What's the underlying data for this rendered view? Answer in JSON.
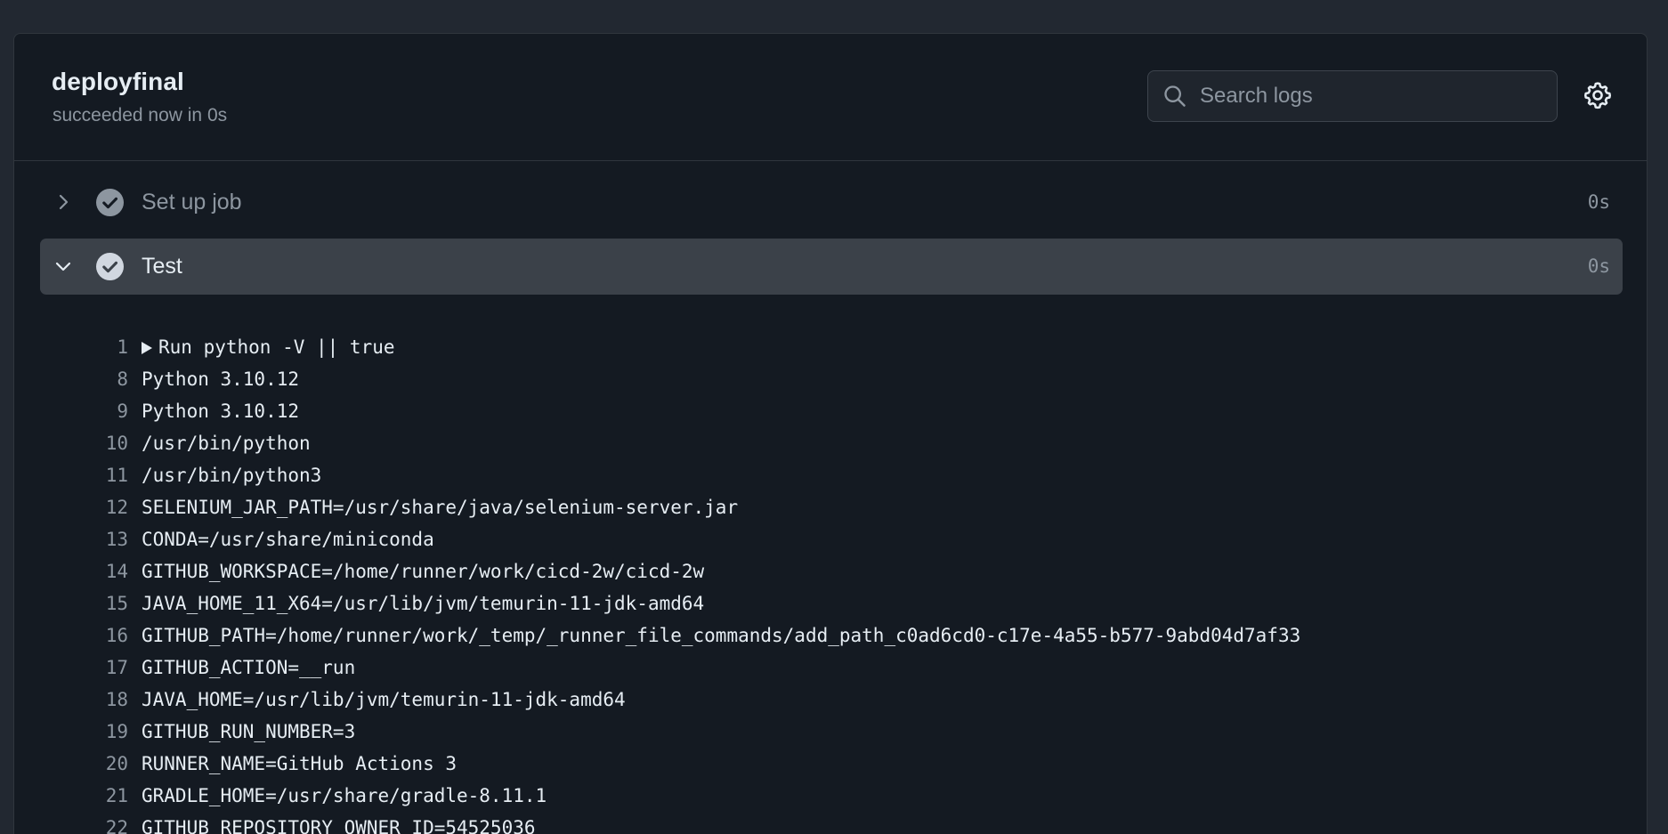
{
  "job": {
    "title": "deployfinal",
    "subtitle": "succeeded now in 0s"
  },
  "search": {
    "placeholder": "Search logs"
  },
  "icons": {
    "search": "search-icon",
    "settings": "gear-icon",
    "step_status": "check-circle-icon",
    "collapsed": "chevron-right-icon",
    "expanded": "chevron-down-icon",
    "group": "triangle-right-icon"
  },
  "colors": {
    "panel_bg": "#141a22",
    "expanded_step_bg": "#3b4149",
    "muted_text": "#8d96a0"
  },
  "steps": [
    {
      "name": "Set up job",
      "duration": "0s",
      "expanded": false
    },
    {
      "name": "Test",
      "duration": "0s",
      "expanded": true
    }
  ],
  "log": [
    {
      "num": "1",
      "text": "Run python -V || true",
      "group": true
    },
    {
      "num": "8",
      "text": "Python 3.10.12"
    },
    {
      "num": "9",
      "text": "Python 3.10.12"
    },
    {
      "num": "10",
      "text": "/usr/bin/python"
    },
    {
      "num": "11",
      "text": "/usr/bin/python3"
    },
    {
      "num": "12",
      "text": "SELENIUM_JAR_PATH=/usr/share/java/selenium-server.jar"
    },
    {
      "num": "13",
      "text": "CONDA=/usr/share/miniconda"
    },
    {
      "num": "14",
      "text": "GITHUB_WORKSPACE=/home/runner/work/cicd-2w/cicd-2w"
    },
    {
      "num": "15",
      "text": "JAVA_HOME_11_X64=/usr/lib/jvm/temurin-11-jdk-amd64"
    },
    {
      "num": "16",
      "text": "GITHUB_PATH=/home/runner/work/_temp/_runner_file_commands/add_path_c0ad6cd0-c17e-4a55-b577-9abd04d7af33"
    },
    {
      "num": "17",
      "text": "GITHUB_ACTION=__run"
    },
    {
      "num": "18",
      "text": "JAVA_HOME=/usr/lib/jvm/temurin-11-jdk-amd64"
    },
    {
      "num": "19",
      "text": "GITHUB_RUN_NUMBER=3"
    },
    {
      "num": "20",
      "text": "RUNNER_NAME=GitHub Actions 3"
    },
    {
      "num": "21",
      "text": "GRADLE_HOME=/usr/share/gradle-8.11.1"
    },
    {
      "num": "22",
      "text": "GITHUB_REPOSITORY_OWNER_ID=54525036"
    }
  ]
}
